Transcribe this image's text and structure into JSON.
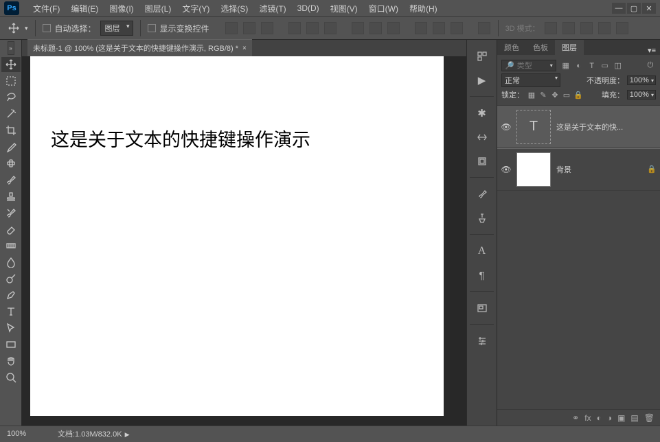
{
  "app": {
    "logo": "Ps"
  },
  "menu": {
    "items": [
      "文件(F)",
      "编辑(E)",
      "图像(I)",
      "图层(L)",
      "文字(Y)",
      "选择(S)",
      "滤镜(T)",
      "3D(D)",
      "视图(V)",
      "窗口(W)",
      "帮助(H)"
    ]
  },
  "options": {
    "auto_select": "自动选择：",
    "target": "图层",
    "show_transform": "显示变换控件",
    "mode3d_label": "3D 模式："
  },
  "doc": {
    "tab_title": "未标题-1 @ 100% (这是关于文本的快捷键操作演示, RGB/8) *",
    "canvas_text": "这是关于文本的快捷键操作演示"
  },
  "panels": {
    "tabs": {
      "color": "颜色",
      "swatch": "色板",
      "layers": "图层"
    },
    "search_placeholder": "类型",
    "blend_mode": "正常",
    "opacity_label": "不透明度：",
    "opacity_value": "100%",
    "lock_label": "锁定：",
    "fill_label": "填充：",
    "fill_value": "100%",
    "layers": [
      {
        "name": "这是关于文本的快...",
        "type": "text",
        "visible": true,
        "selected": true,
        "locked": false
      },
      {
        "name": "背景",
        "type": "raster",
        "visible": true,
        "selected": false,
        "locked": true
      }
    ]
  },
  "status": {
    "zoom": "100%",
    "doc_info": "文档:1.03M/832.0K"
  }
}
